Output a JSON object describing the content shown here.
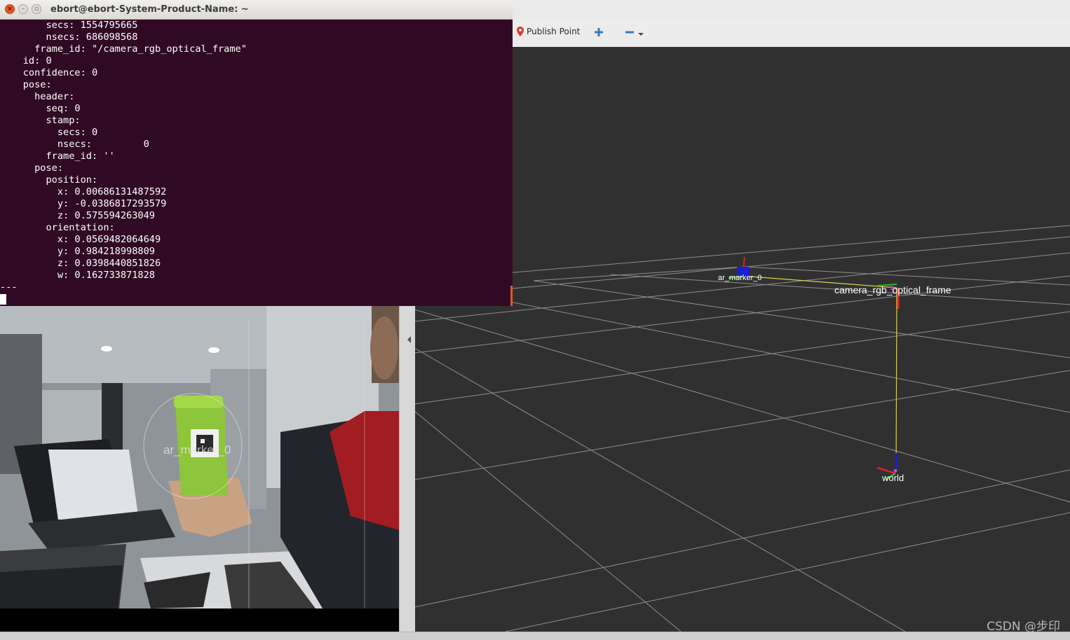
{
  "terminal": {
    "title": "ebort@ebort-System-Product-Name: ~",
    "lines": [
      "        secs: 1554795665",
      "        nsecs: 686098568",
      "      frame_id: \"/camera_rgb_optical_frame\"",
      "    id: 0",
      "    confidence: 0",
      "    pose:",
      "      header:",
      "        seq: 0",
      "        stamp:",
      "          secs: 0",
      "          nsecs:         0",
      "        frame_id: ''",
      "      pose:",
      "        position:",
      "          x: 0.00686131487592",
      "          y: -0.0386817293579",
      "          z: 0.575594263049",
      "        orientation:",
      "          x: 0.0569482064649",
      "          y: 0.984218998809",
      "          z: 0.0398440851826",
      "          w: 0.162733871828",
      "---"
    ],
    "close_glyph": "×",
    "minimize_glyph": "–",
    "maximize_glyph": "▫"
  },
  "rviz": {
    "toolbar": {
      "publish_point_label": "Publish Point",
      "publish_point_icon": "map-pin-icon",
      "add_tool_icon": "plus-icon",
      "remove_tool_icon": "minus-icon"
    },
    "frames": {
      "marker": "ar_marker_0",
      "camera": "camera_rgb_optical_frame",
      "world": "world"
    },
    "colors": {
      "background": "#303030",
      "grid": "#a0a0a0",
      "link": "#d8d050"
    }
  },
  "camera_view": {
    "overlay_label": "ar_marker_0"
  },
  "watermark": "CSDN @步印"
}
